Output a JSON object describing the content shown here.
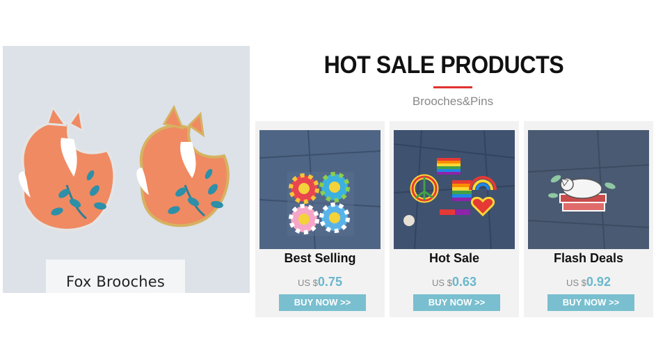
{
  "hero": {
    "caption": "Fox Brooches"
  },
  "section": {
    "title": "HOT SALE PRODUCTS",
    "subtitle": "Brooches&Pins",
    "accent_color": "#e0322f"
  },
  "products": [
    {
      "title": "Best Selling",
      "currency": "US $",
      "price": "0.75",
      "button": "BUY NOW >>"
    },
    {
      "title": "Hot Sale",
      "currency": "US $",
      "price": "0.63",
      "button": "BUY NOW >>"
    },
    {
      "title": "Flash Deals",
      "currency": "US $",
      "price": "0.92",
      "button": "BUY NOW >>"
    }
  ],
  "colors": {
    "price": "#6ab7cc",
    "button": "#79bfcf",
    "card_bg": "#f2f2f2"
  }
}
